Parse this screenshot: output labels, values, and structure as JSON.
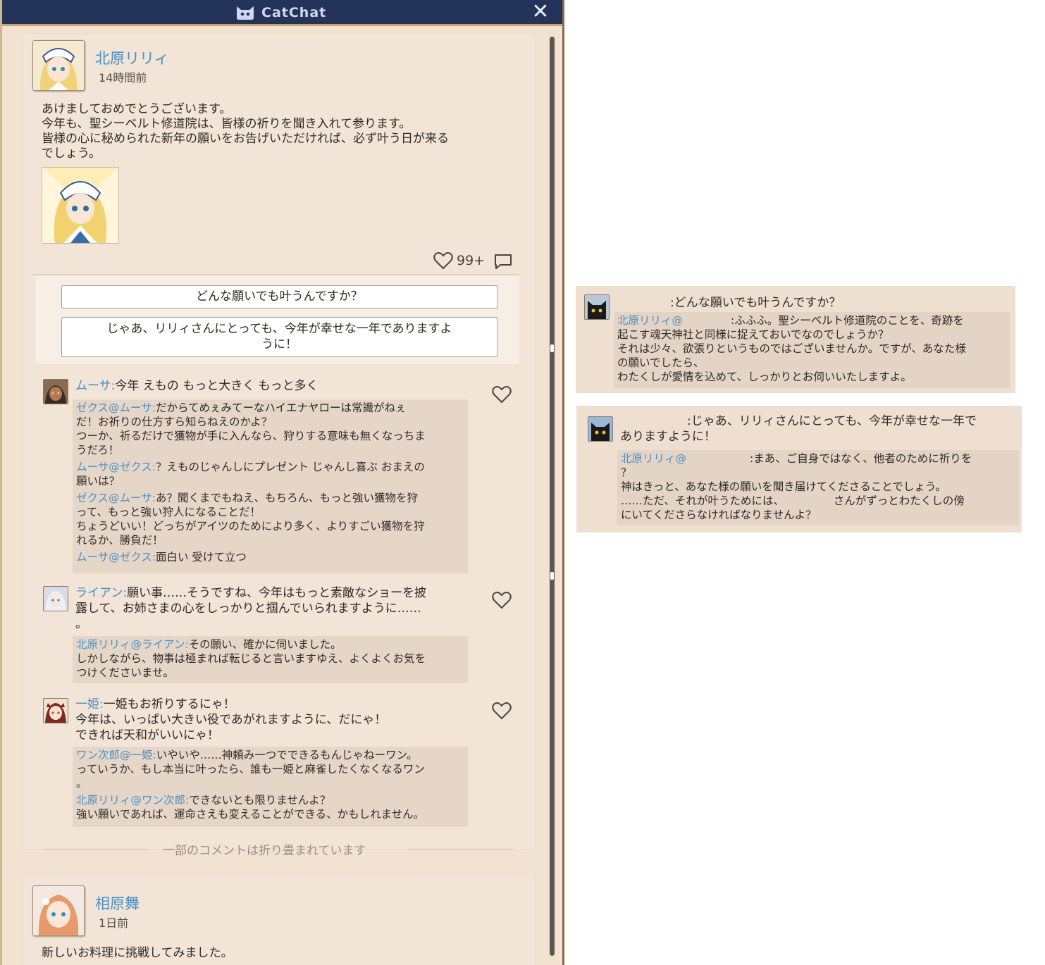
{
  "app": {
    "title": "CatChat"
  },
  "posts": [
    {
      "author": "北原リリィ",
      "time": "14時間前",
      "text_lines": [
        "あけましておめでとうございます。",
        "今年も、聖シーベルト修道院は、皆様の祈りを聞き入れて参ります。",
        "皆様の心に秘められた新年の願いをお告げいただければ、必ず叶う日が来る",
        "でしょう。"
      ],
      "likes": "99+",
      "replies": [
        "どんな願いでも叶うんですか？"
      ],
      "reply2_lines": [
        "じゃあ、リリィさんにとっても、今年が幸せな一年でありますよ",
        "うに！"
      ],
      "comments": [
        {
          "name": "ムーサ",
          "text": "今年 えもの もっと大きく もっと多く",
          "subs": [
            {
              "from": "ゼクス",
              "to": "ムーサ",
              "lines": [
                "だからてめぇみてーなハイエナヤローは常識がねぇ",
                "だ！お祈りの仕方すら知らねえのかよ？",
                "つーか、祈るだけで獲物が手に入んなら、狩りする意味も無くなっちま",
                "うだろ！"
              ]
            },
            {
              "from": "ムーサ",
              "to": "ゼクス",
              "lines": [
                "？えものじゃんしにプレゼント じゃんし喜ぶ おまえの",
                "願いは？"
              ]
            },
            {
              "from": "ゼクス",
              "to": "ムーサ",
              "lines": [
                "あ？聞くまでもねえ、もちろん、もっと強い獲物を狩",
                "って、もっと強い狩人になることだ！",
                "ちょうどいい！どっちがアイツのためにより多く、よりすごい獲物を狩",
                "れるか、勝負だ！"
              ]
            },
            {
              "from": "ムーサ",
              "to": "ゼクス",
              "lines": [
                "面白い 受けて立つ"
              ]
            }
          ]
        },
        {
          "name": "ライアン",
          "lines": [
            "願い事……そうですね、今年はもっと素敵なショーを披",
            "露して、お姉さまの心をしっかりと掴んでいられますように……",
            "。"
          ],
          "subs": [
            {
              "from": "北原リリィ",
              "to": "ライアン",
              "lines": [
                "その願い、確かに伺いました。",
                "しかしながら、物事は極まれば転じると言いますゆえ、よくよくお気を",
                "つけくださいませ。"
              ]
            }
          ]
        },
        {
          "name": "一姫",
          "lines": [
            "一姫もお祈りするにゃ！",
            "今年は、いっぱい大きい役であがれますように、だにゃ！",
            "できれば天和がいいにゃ！"
          ],
          "subs": [
            {
              "from": "ワン次郎",
              "to": "一姫",
              "lines": [
                "いやいや……神頼み一つでできるもんじゃねーワン。",
                "っていうか、もし本当に叶ったら、誰も一姫と麻雀したくなくなるワン",
                "。"
              ]
            },
            {
              "from": "北原リリィ",
              "to": "ワン次郎",
              "lines": [
                "できないとも限りませんよ？",
                "強い願いであれば、運命さえも変えることができる、かもしれません。"
              ]
            }
          ]
        }
      ],
      "collapsed_note": "一部のコメントは折り畳まれています"
    },
    {
      "author": "相原舞",
      "time": "1日前",
      "text_lines": [
        "新しいお料理に挑戦してみました。"
      ]
    }
  ],
  "side_panels": [
    {
      "message": ":どんな願いでも叶うんですか？",
      "reply_from": "北原リリィ@",
      "reply_lines": [
        ":ふふふ。聖シーベルト修道院のことを、奇跡を",
        "起こす魂天神社と同様に捉えておいでなのでしょうか？",
        "それは少々、欲張りというものではございませんか。ですが、あなた様",
        "の願いでしたら、",
        "わたくしが愛情を込めて、しっかりとお伺いいたしますよ。"
      ]
    },
    {
      "message_lines": [
        ":じゃあ、リリィさんにとっても、今年が幸せな一年で",
        "ありますように！"
      ],
      "reply_from": "北原リリィ@",
      "reply_lines": [
        ":まあ、ご自身ではなく、他者のために祈りを",
        "？",
        "神はきっと、あなた様の願いを聞き届けてくださることでしょう。",
        "……ただ、それが叶うためには、　　　　　さんがずっとわたくしの傍",
        "にいてくださらなければなりませんよ？"
      ]
    }
  ],
  "colors": {
    "name_blue": "#4a8fc4",
    "titlebar": "#23335a",
    "panel_bg": "#f2e2d2"
  }
}
